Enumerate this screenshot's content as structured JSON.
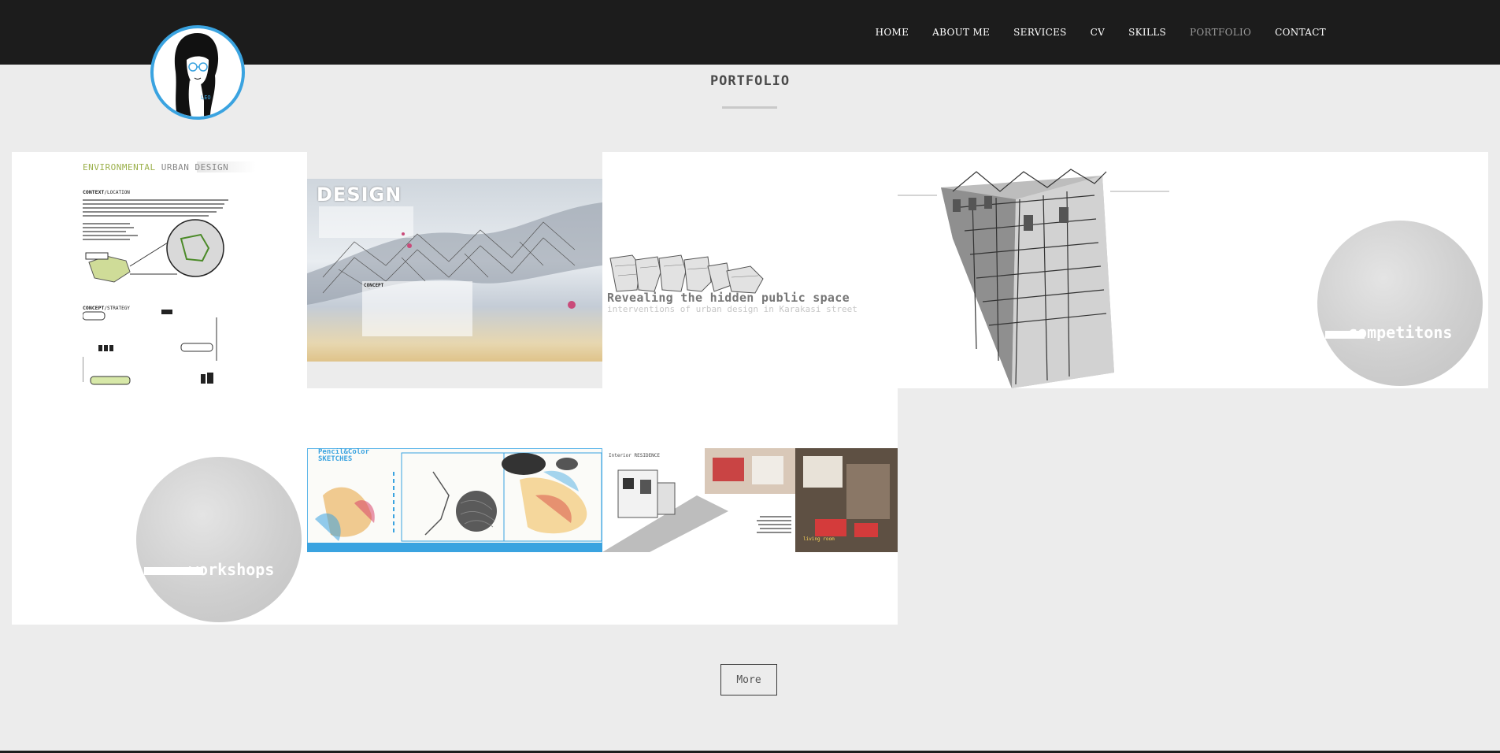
{
  "nav": {
    "items": [
      "HOME",
      "ABOUT ME",
      "SERVICES",
      "CV",
      "SKILLS",
      "PORTFOLIO",
      "CONTACT"
    ],
    "active": "PORTFOLIO"
  },
  "logo": {
    "text": "LEO"
  },
  "page": {
    "title": "PORTFOLIO"
  },
  "portfolio": {
    "environmental": {
      "title_a": "ENVIRONMENTAL ",
      "title_b": "URBAN DESIGN",
      "context": "CONTEXT",
      "context_b": "/LOCATION",
      "concept": "CONCEPT",
      "concept_b": "/STRATEGY"
    },
    "design": {
      "title": "DESIGN",
      "concept": "CONCEPT"
    },
    "revealing": {
      "title": "Revealing the hidden public space",
      "subtitle": "interventions of urban design in Karakasi street"
    },
    "competitions": {
      "label": "competitons"
    },
    "workshops": {
      "label": "workshops"
    },
    "sketches": {
      "title_a": "Pencil&Color",
      "title_b": "SKETCHES"
    },
    "residence": {
      "title": "Interior RESIDENCE",
      "caption": "living room"
    }
  },
  "more_button": {
    "label": "More"
  },
  "colors": {
    "accent": "#3aa3e0",
    "header": "#1c1c1c",
    "background": "#ececec",
    "env_green": "#9bb04b"
  }
}
